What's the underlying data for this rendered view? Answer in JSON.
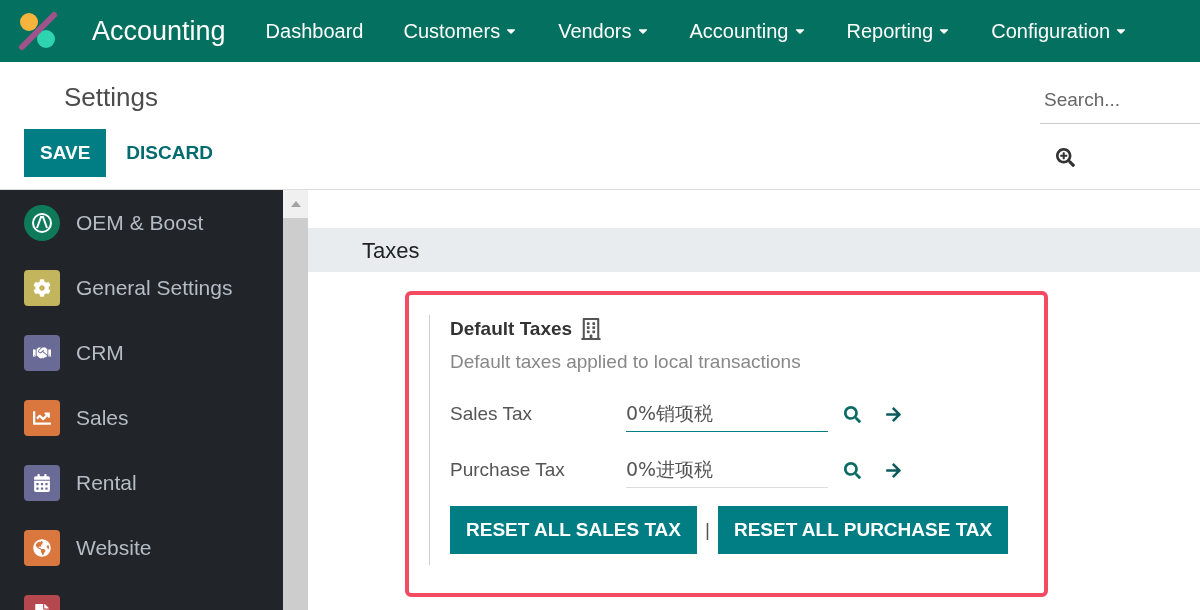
{
  "navbar": {
    "app_name": "Accounting",
    "menu": [
      {
        "label": "Dashboard",
        "dropdown": false
      },
      {
        "label": "Customers",
        "dropdown": true
      },
      {
        "label": "Vendors",
        "dropdown": true
      },
      {
        "label": "Accounting",
        "dropdown": true
      },
      {
        "label": "Reporting",
        "dropdown": true
      },
      {
        "label": "Configuration",
        "dropdown": true
      }
    ]
  },
  "control_panel": {
    "title": "Settings",
    "buttons": [
      {
        "label": "SAVE",
        "kind": "primary"
      },
      {
        "label": "DISCARD",
        "kind": "link"
      }
    ],
    "search": {
      "placeholder": "Search..."
    }
  },
  "sidebar": {
    "items": [
      {
        "label": "OEM & Boost",
        "kind": "ai",
        "color": "#0f7a5a"
      },
      {
        "label": "General Settings",
        "kind": "gear",
        "color": "#c2b55e"
      },
      {
        "label": "CRM",
        "kind": "handshake",
        "color": "#6a6a96"
      },
      {
        "label": "Sales",
        "kind": "chart",
        "color": "#d9773f"
      },
      {
        "label": "Rental",
        "kind": "calendar",
        "color": "#6a6a96"
      },
      {
        "label": "Website",
        "kind": "globe",
        "color": "#d9773f"
      },
      {
        "kind": "doc",
        "color": "#b5474f"
      }
    ]
  },
  "section": {
    "title": "Taxes",
    "setting": {
      "highlighted": true,
      "title": "Default Taxes",
      "description": "Default taxes applied to local transactions",
      "fields": [
        {
          "label": "Sales Tax",
          "value": "0%销项税",
          "focused": true
        },
        {
          "label": "Purchase Tax",
          "value": "0%进项税",
          "focused": false
        }
      ],
      "buttons": [
        "RESET ALL SALES TAX",
        "RESET ALL PURCHASE TAX"
      ],
      "separator": "|"
    }
  }
}
